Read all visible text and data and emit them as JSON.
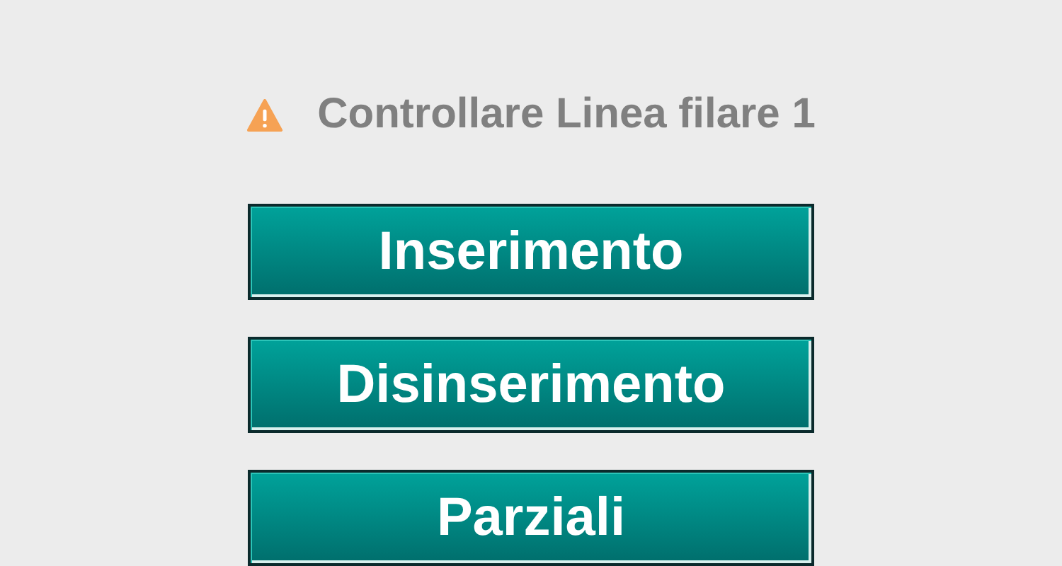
{
  "warning": {
    "text": "Controllare Linea filare 1"
  },
  "buttons": [
    {
      "label": "Inserimento"
    },
    {
      "label": "Disinserimento"
    },
    {
      "label": "Parziali"
    }
  ]
}
